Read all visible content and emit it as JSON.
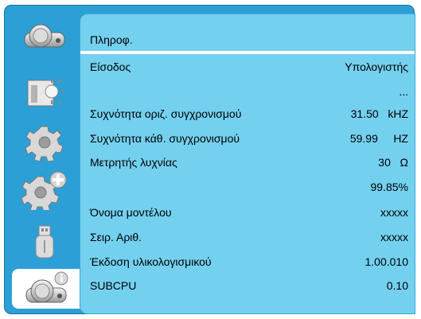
{
  "sidebar": {
    "items": [
      {
        "name": "projector-icon"
      },
      {
        "name": "screen-brightness-icon"
      },
      {
        "name": "gear-icon"
      },
      {
        "name": "gear-plus-icon"
      },
      {
        "name": "usb-icon"
      },
      {
        "name": "projector-info-icon"
      }
    ]
  },
  "panel": {
    "title": "Πληροφ.",
    "rows": [
      {
        "label": "Είσοδος",
        "value": "Υπολογιστής"
      },
      {
        "label": "",
        "value": "..."
      },
      {
        "label": "Συχνότητα οριζ. συγχρονισμού",
        "value": "31.50   kHZ"
      },
      {
        "label": "Συχνότητα κάθ. συγχρονισμού",
        "value": "59.99     HZ"
      },
      {
        "label": "Μετρητής λυχνίας",
        "value": "30   Ω"
      },
      {
        "label": "",
        "value": "99.85%"
      },
      {
        "label": "Όνομα μοντέλου",
        "value": "xxxxx"
      },
      {
        "label": "Σειρ. Αριθ.",
        "value": "xxxxx"
      },
      {
        "label": "Έκδοση υλικολογισμικού",
        "value": "1.00.010"
      },
      {
        "label": "SUBCPU",
        "value": "0.10"
      }
    ]
  },
  "colors": {
    "frame": "#2b9fd6",
    "panel": "#74d0ef",
    "active_tab": "#ffffff"
  }
}
